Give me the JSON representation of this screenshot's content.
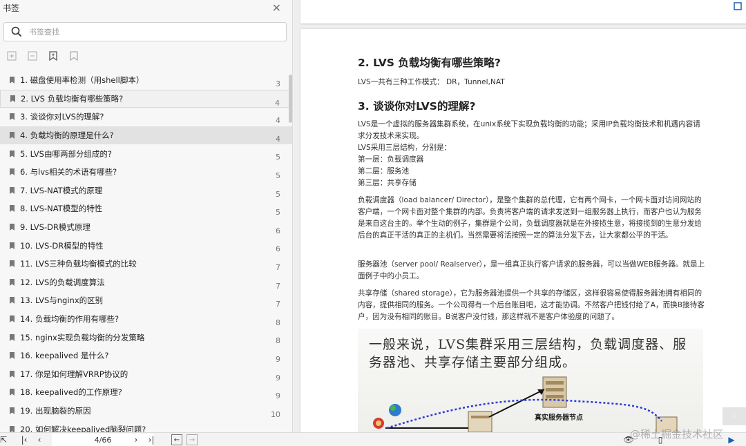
{
  "sidebar": {
    "title": "书签",
    "search_placeholder": "书签查找",
    "items": [
      {
        "label": "1. 磁盘使用率检测（用shell脚本）",
        "page": "3"
      },
      {
        "label": "2. LVS 负载均衡有哪些策略?",
        "page": "4"
      },
      {
        "label": "3. 谈谈你对LVS的理解?",
        "page": "4"
      },
      {
        "label": "4. 负载均衡的原理是什么?",
        "page": "4"
      },
      {
        "label": "5. LVS由哪两部分组成的?",
        "page": "5"
      },
      {
        "label": "6. 与lvs相关的术语有哪些?",
        "page": "5"
      },
      {
        "label": "7. LVS-NAT模式的原理",
        "page": "5"
      },
      {
        "label": "8. LVS-NAT模型的特性",
        "page": "5"
      },
      {
        "label": "9. LVS-DR模式原理",
        "page": "6"
      },
      {
        "label": "10. LVS-DR模型的特性",
        "page": "6"
      },
      {
        "label": "11. LVS三种负载均衡模式的比较",
        "page": "7"
      },
      {
        "label": "12. LVS的负载调度算法",
        "page": "7"
      },
      {
        "label": "13. LVS与nginx的区别",
        "page": "7"
      },
      {
        "label": "14. 负载均衡的作用有哪些?",
        "page": "8"
      },
      {
        "label": "15. nginx实现负载均衡的分发策略",
        "page": "8"
      },
      {
        "label": "16. keepalived 是什么?",
        "page": "9"
      },
      {
        "label": "17. 你是如何理解VRRP协议的",
        "page": "9"
      },
      {
        "label": "18. keepalived的工作原理?",
        "page": "9"
      },
      {
        "label": "19. 出现脑裂的原因",
        "page": "10"
      },
      {
        "label": "20. 如何解决keepalived脑裂问题?",
        "page": ""
      }
    ]
  },
  "document": {
    "heading_2": "2. LVS 负载均衡有哪些策略?",
    "modes_text": "LVS一共有三种工作模式： DR，Tunnel,NAT",
    "heading_3": "3. 谈谈你对LVS的理解?",
    "intro_lines": [
      "LVS是一个虚拟的服务器集群系统，在unix系统下实现负载均衡的功能；采用IP负载均衡技术和机遇内容请求分发技术来实现。",
      "LVS采用三层结构，分别是：",
      "第一层：负载调度器",
      "第二层：服务池",
      "第三层：共享存储"
    ],
    "load_balancer_para": "负载调度器（load balancer/ Director），是整个集群的总代理，它有两个网卡，一个网卡面对访问网站的客户端，一个网卡面对整个集群的内部。负责将客户端的请求发送到一组服务器上执行，而客户也认为服务是来自这台主的。举个生动的例子，集群是个公司，负载调度器就是在外接揽生意，将接揽到的生意分发给后台的真正干活的真正的主机们。当然需要将活按照一定的算法分发下去，让大家都公平的干活。",
    "server_pool_para": "服务器池（server pool/ Realserver），是一组真正执行客户请求的服务器，可以当做WEB服务器。就是上面例子中的小员工。",
    "shared_storage_para": "共享存储（shared storage），它为服务器池提供一个共享的存储区，这样很容易使得服务器池拥有相同的内容，提供相同的服务。一个公司得有一个后台账目吧，这才能协调。不然客户把钱付给了A，而换B接待客户，因为没有相同的账目。B说客户没付钱，那这样就不是客户体验度的问题了。",
    "illustration": {
      "caption": "一般来说，LVS集群采用三层结构，负载调度器、服务器池、共享存储主要部分组成。",
      "node_label": "真实服务器节点"
    }
  },
  "bottom_bar": {
    "page_indicator": "4/66"
  },
  "watermark": "@稀土掘金技术社区",
  "colors": {
    "sidebar_bg": "#f7f7f7",
    "selected_row": "#e2e2e2",
    "doc_bg": "#eeeeee",
    "accent_blue": "#1a5fb4",
    "arrow_dots": "#2a3bd6"
  }
}
